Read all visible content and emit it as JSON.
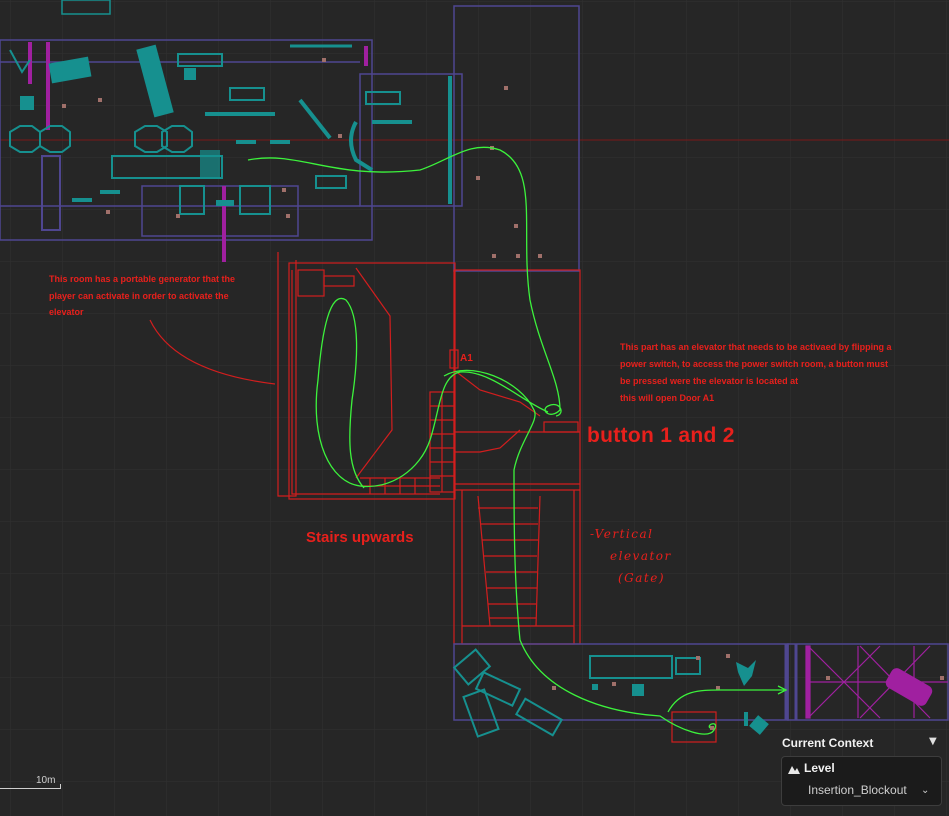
{
  "annotations": {
    "generator_note": "This room has a portable generator that the player can activate in order to activate the elevator",
    "elevator_note_lines": [
      "This part has an elevator that needs to be activaed by flipping a",
      "power switch, to access the power switch room, a button must",
      "be pressed were the elevator is located at",
      "this will open Door A1"
    ],
    "buttons_label": "button 1 and 2",
    "stairs_label": "Stairs upwards",
    "door_label": "A1",
    "vertical_elevator_lines": [
      "-Vertical",
      "elevator",
      "(Gate)"
    ]
  },
  "scale": {
    "label": "10m"
  },
  "context": {
    "title": "Current Context",
    "level_label": "Level",
    "level_value": "Insertion_Blockout"
  },
  "colors": {
    "background": "#262626",
    "grid": "#303030",
    "annotation_red": "#e8201c",
    "path_green": "#3cf23c",
    "prop_teal": "#16908f",
    "boundary_purple": "#4f4690",
    "volume_magenta": "#a020a0"
  }
}
